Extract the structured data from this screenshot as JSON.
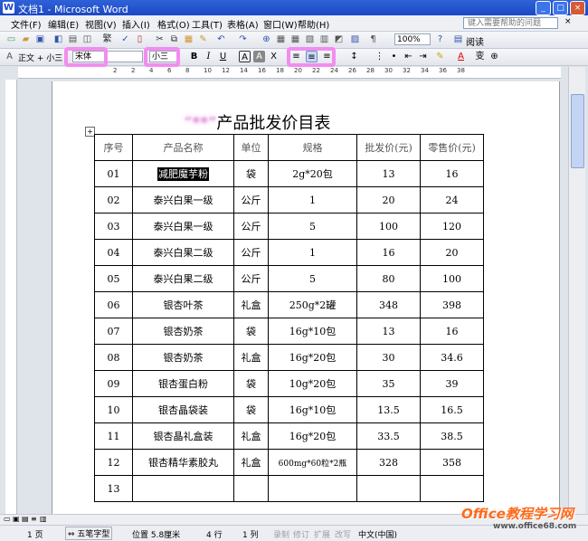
{
  "window": {
    "title": "文档1 - Microsoft Word",
    "min": "_",
    "max": "□",
    "close": "×"
  },
  "menu": [
    "文件(F)",
    "编辑(E)",
    "视图(V)",
    "插入(I)",
    "格式(O)",
    "工具(T)",
    "表格(A)",
    "窗口(W)",
    "帮助(H)"
  ],
  "help_placeholder": "键入需要帮助的问题",
  "toolbar1": {
    "zoom": "100%",
    "read_label": "阅读"
  },
  "toolbar2": {
    "style": "正文 + 小三",
    "font": "宋体",
    "size": "小三"
  },
  "document": {
    "title_blurred": "“**”",
    "title": "产品批发价目表",
    "headers": [
      "序号",
      "产品名称",
      "单位",
      "规格",
      "批发价(元)",
      "零售价(元)"
    ],
    "rows": [
      [
        "01",
        "减肥魔芋粉",
        "袋",
        "2g*20包",
        "13",
        "16"
      ],
      [
        "02",
        "泰兴白果一级",
        "公斤",
        "1",
        "20",
        "24"
      ],
      [
        "03",
        "泰兴白果一级",
        "公斤",
        "5",
        "100",
        "120"
      ],
      [
        "04",
        "泰兴白果二级",
        "公斤",
        "1",
        "16",
        "20"
      ],
      [
        "05",
        "泰兴白果二级",
        "公斤",
        "5",
        "80",
        "100"
      ],
      [
        "06",
        "银杏叶茶",
        "礼盒",
        "250g*2罐",
        "348",
        "398"
      ],
      [
        "07",
        "银杏奶茶",
        "袋",
        "16g*10包",
        "13",
        "16"
      ],
      [
        "08",
        "银杏奶茶",
        "礼盒",
        "16g*20包",
        "30",
        "34.6"
      ],
      [
        "09",
        "银杏蛋白粉",
        "袋",
        "10g*20包",
        "35",
        "39"
      ],
      [
        "10",
        "银杏晶袋装",
        "袋",
        "16g*10包",
        "13.5",
        "16.5"
      ],
      [
        "11",
        "银杏晶礼盒装",
        "礼盒",
        "16g*20包",
        "33.5",
        "38.5"
      ],
      [
        "12",
        "银杏精华素胶丸",
        "礼盒",
        "600mg*60粒*2瓶",
        "328",
        "358"
      ],
      [
        "13",
        "",
        "",
        "",
        "",
        ""
      ]
    ]
  },
  "status": {
    "page": "1 页",
    "ime": "五笔字型",
    "position": "位置 5.8厘米",
    "line": "4 行",
    "col": "1 列",
    "rec": "录制",
    "trk": "修订",
    "ext": "扩展",
    "ovr": "改写",
    "lang": "中文(中国)"
  },
  "watermark": {
    "main": "Office教程学习网",
    "sub": "www.office68.com"
  },
  "colors": {
    "titlebar": "#1b48c4",
    "highlight": "#f38cf0",
    "selection": "#000000",
    "watermark": "#ff6a1a"
  }
}
